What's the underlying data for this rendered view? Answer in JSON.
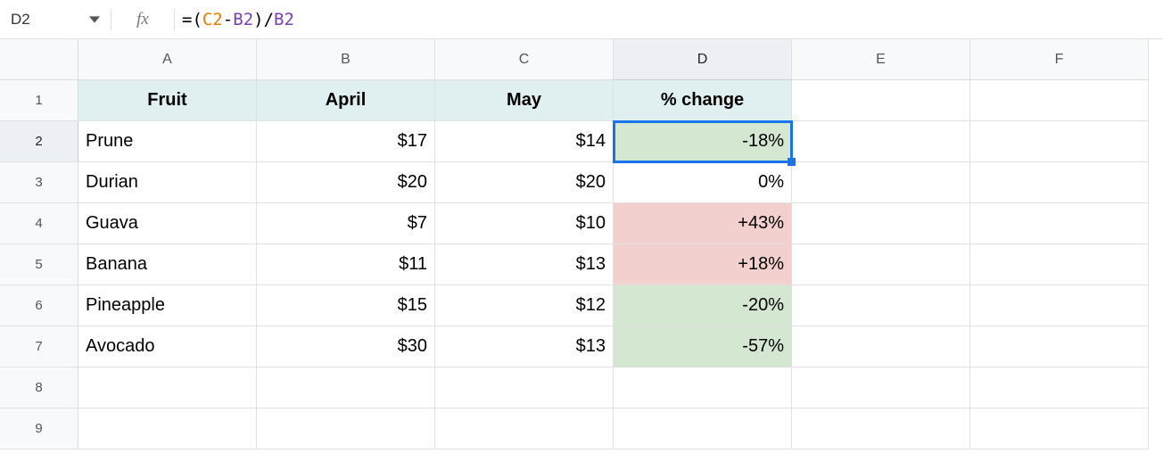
{
  "nameBox": "D2",
  "formula": {
    "eq": "=",
    "lp": "(",
    "c2": "C2",
    "minus": "-",
    "b2a": "B2",
    "rp": ")",
    "slash": "/",
    "b2b": "B2"
  },
  "columns": [
    "A",
    "B",
    "C",
    "D",
    "E",
    "F"
  ],
  "headers": {
    "A": "Fruit",
    "B": "April",
    "C": "May",
    "D": "% change"
  },
  "rows": [
    {
      "n": "2",
      "A": "Prune",
      "B": "$17",
      "C": "$14",
      "D": "-18%",
      "Dclass": "green",
      "sel": true
    },
    {
      "n": "3",
      "A": "Durian",
      "B": "$20",
      "C": "$20",
      "D": "0%",
      "Dclass": ""
    },
    {
      "n": "4",
      "A": "Guava",
      "B": "$7",
      "C": "$10",
      "D": "+43%",
      "Dclass": "red"
    },
    {
      "n": "5",
      "A": "Banana",
      "B": "$11",
      "C": "$13",
      "D": "+18%",
      "Dclass": "red"
    },
    {
      "n": "6",
      "A": "Pineapple",
      "B": "$15",
      "C": "$12",
      "D": "-20%",
      "Dclass": "green"
    },
    {
      "n": "7",
      "A": "Avocado",
      "B": "$30",
      "C": "$13",
      "D": "-57%",
      "Dclass": "green"
    },
    {
      "n": "8",
      "A": "",
      "B": "",
      "C": "",
      "D": "",
      "Dclass": ""
    },
    {
      "n": "9",
      "A": "",
      "B": "",
      "C": "",
      "D": "",
      "Dclass": ""
    }
  ],
  "chart_data": {
    "type": "table",
    "columns": [
      "Fruit",
      "April",
      "May",
      "% change"
    ],
    "data": [
      [
        "Prune",
        17,
        14,
        -0.18
      ],
      [
        "Durian",
        20,
        20,
        0.0
      ],
      [
        "Guava",
        7,
        10,
        0.43
      ],
      [
        "Banana",
        11,
        13,
        0.18
      ],
      [
        "Pineapple",
        15,
        12,
        -0.2
      ],
      [
        "Avocado",
        30,
        13,
        -0.57
      ]
    ]
  }
}
